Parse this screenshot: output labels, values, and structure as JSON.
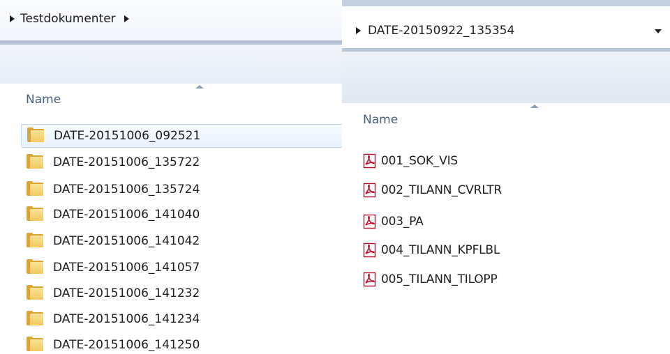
{
  "left_pane": {
    "breadcrumb": "Testdokumenter",
    "column_header": "Name",
    "folder_icon": "folder-icon",
    "items": [
      {
        "name": "DATE-20151006_092521",
        "selected": true
      },
      {
        "name": "DATE-20151006_135722"
      },
      {
        "name": "DATE-20151006_135724"
      },
      {
        "name": "DATE-20151006_141040"
      },
      {
        "name": "DATE-20151006_141042"
      },
      {
        "name": "DATE-20151006_141057"
      },
      {
        "name": "DATE-20151006_141232"
      },
      {
        "name": "DATE-20151006_141234"
      },
      {
        "name": "DATE-20151006_141250"
      }
    ]
  },
  "right_pane": {
    "breadcrumb": "DATE-20150922_135354",
    "column_header": "Name",
    "file_icon": "pdf-icon",
    "items": [
      {
        "name": "001_SOK_VIS"
      },
      {
        "name": "002_TILANN_CVRLTR"
      },
      {
        "name": "003_PA"
      },
      {
        "name": "004_TILANN_KPFLBL"
      },
      {
        "name": "005_TILANN_TILOPP"
      }
    ]
  },
  "colors": {
    "folder": "#f1c95f",
    "pdf": "#c8102e",
    "header_text": "#4c607a",
    "selection": "#e9f2fd"
  }
}
